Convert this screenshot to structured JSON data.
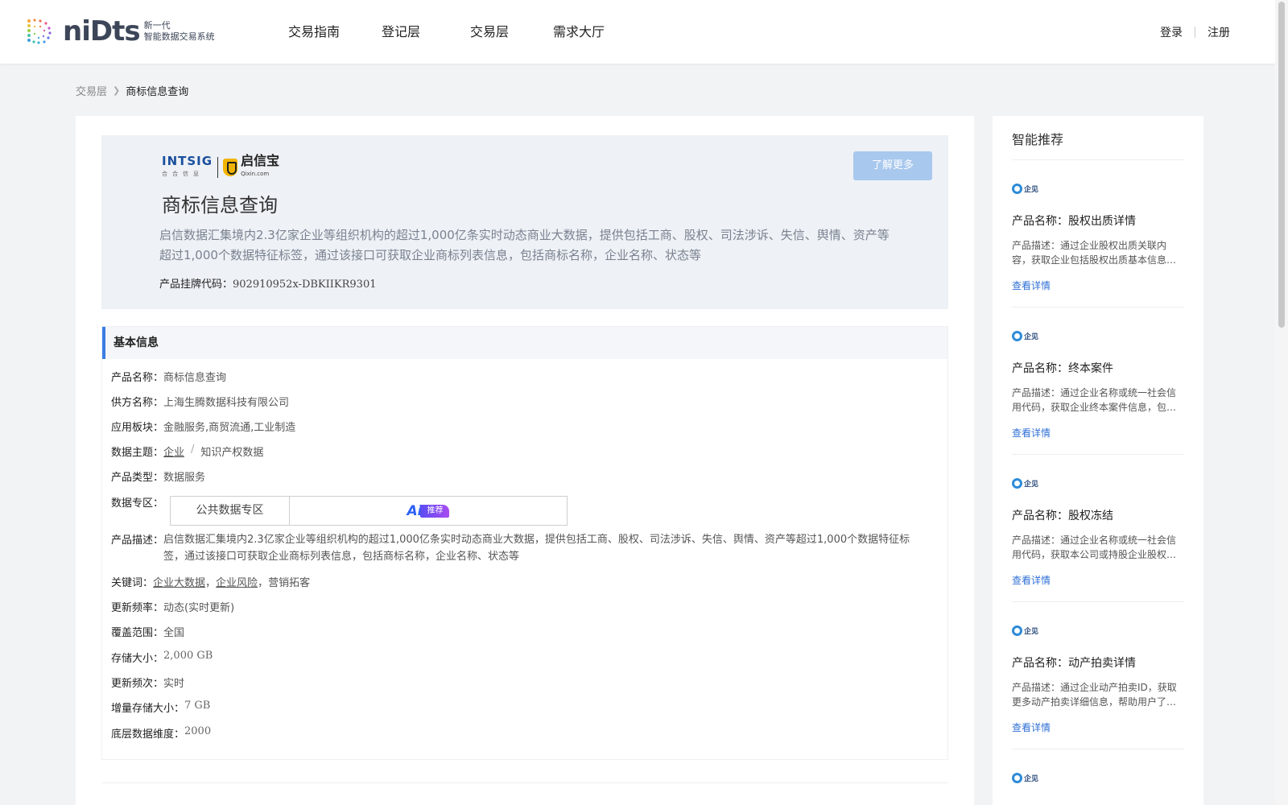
{
  "header": {
    "logo_word": "niDts",
    "logo_sub_1": "新一代",
    "logo_sub_2": "智能数据交易系统",
    "nav": [
      "交易指南",
      "登记层",
      "交易层",
      "需求大厅"
    ],
    "login": "登录",
    "register": "注册"
  },
  "breadcrumb": {
    "parent": "交易层",
    "current": "商标信息查询"
  },
  "hero": {
    "brand_intsig": "INTSIG",
    "brand_intsig_sub": "合合信息",
    "brand_qixin": "启信宝",
    "brand_qixin_sub": "Qixin.com",
    "more_button": "了解更多",
    "title": "商标信息查询",
    "description": "启信数据汇集境内2.3亿家企业等组织机构的超过1,000亿条实时动态商业大数据，提供包括工商、股权、司法涉诉、失信、舆情、资产等超过1,000个数据特征标签，通过该接口可获取企业商标列表信息，包括商标名称，企业名称、状态等",
    "code_label": "产品挂牌代码：",
    "code_value": "902910952x-DBKIIKR9301"
  },
  "basic_info": {
    "heading": "基本信息",
    "product_name_label": "产品名称：",
    "product_name": "商标信息查询",
    "supplier_label": "供方名称：",
    "supplier": "上海生腾数据科技有限公司",
    "sector_label": "应用板块：",
    "sector": "金融服务,商贸流通,工业制造",
    "theme_label": "数据主题：",
    "theme_1": "企业",
    "theme_2": "知识产权数据",
    "type_label": "产品类型：",
    "type": "数据服务",
    "zone_label": "数据专区：",
    "zone_value": "公共数据专区",
    "ai_text": "Ai",
    "ai_tag": "推荐",
    "desc_label": "产品描述：",
    "desc": "启信数据汇集境内2.3亿家企业等组织机构的超过1,000亿条实时动态商业大数据，提供包括工商、股权、司法涉诉、失信、舆情、资产等超过1,000个数据特征标签，通过该接口可获取企业商标列表信息，包括商标名称，企业名称、状态等",
    "keywords_label": "关键词：",
    "keywords": [
      "企业大数据",
      "企业风险",
      "营销拓客"
    ],
    "update_freq_label": "更新频率：",
    "update_freq": "动态(实时更新)",
    "coverage_label": "覆盖范围：",
    "coverage": "全国",
    "storage_label": "存储大小：",
    "storage": "2,000 GB",
    "update_times_label": "更新频次：",
    "update_times": "实时",
    "incr_label": "增量存储大小：",
    "incr": "7 GB",
    "dims_label": "底层数据维度：",
    "dims": "2000"
  },
  "sidebar": {
    "title": "智能推荐",
    "logo_text": "企见",
    "link_label": "查看详情",
    "items": [
      {
        "name": "产品名称：股权出质详情",
        "desc": "产品描述：通过企业股权出质关联内容，获取企业包括股权出质基本信息等内容"
      },
      {
        "name": "产品名称：终本案件",
        "desc": "产品描述：通过企业名称或统一社会信用代码，获取企业终本案件信息，包括案号等内容"
      },
      {
        "name": "产品名称：股权冻结",
        "desc": "产品描述：通过企业名称或统一社会信用代码，获取本公司或持股企业股权冻结信息"
      },
      {
        "name": "产品名称：动产拍卖详情",
        "desc": "产品描述：通过企业动产拍卖ID，获取更多动产拍卖详细信息，帮助用户了解拍卖情况"
      }
    ]
  }
}
